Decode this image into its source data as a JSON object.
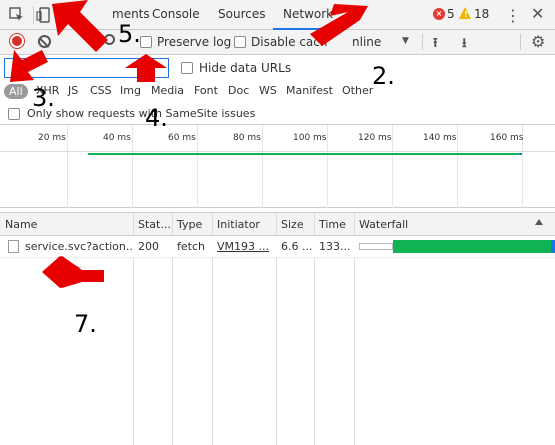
{
  "tabs": {
    "partial": "ments",
    "console": "Console",
    "sources": "Sources",
    "network": "Network",
    "more": "»"
  },
  "status": {
    "errors": "5",
    "warnings": "18"
  },
  "toolbar": {
    "preserve_log": "Preserve log",
    "disable_cache": "Disable cach",
    "online": "nline"
  },
  "filter": {
    "value": "",
    "hide_data_urls": "Hide data URLs"
  },
  "types": [
    "All",
    "XHR",
    "JS",
    "CSS",
    "Img",
    "Media",
    "Font",
    "Doc",
    "WS",
    "Manifest",
    "Other"
  ],
  "only_samesite": "Only show requests with SameSite issues",
  "overview": {
    "ticks": [
      "20 ms",
      "40 ms",
      "60 ms",
      "80 ms",
      "100 ms",
      "120 ms",
      "140 ms",
      "160 ms"
    ]
  },
  "table": {
    "headers": {
      "name": "Name",
      "status": "Stat...",
      "type": "Type",
      "initiator": "Initiator",
      "size": "Size",
      "time": "Time",
      "waterfall": "Waterfall"
    },
    "rows": [
      {
        "name": "service.svc?action...",
        "status": "200",
        "type": "fetch",
        "initiator": "VM193 ...",
        "size": "6.6 ...",
        "time": "133..."
      }
    ]
  },
  "annotations": [
    "2.",
    "3.",
    "4.",
    "5.",
    "7."
  ],
  "colors": {
    "record": "#d93025",
    "accent": "#1a73e8",
    "waterfall": "#0fb353",
    "annotation_arrow": "#e60000"
  }
}
